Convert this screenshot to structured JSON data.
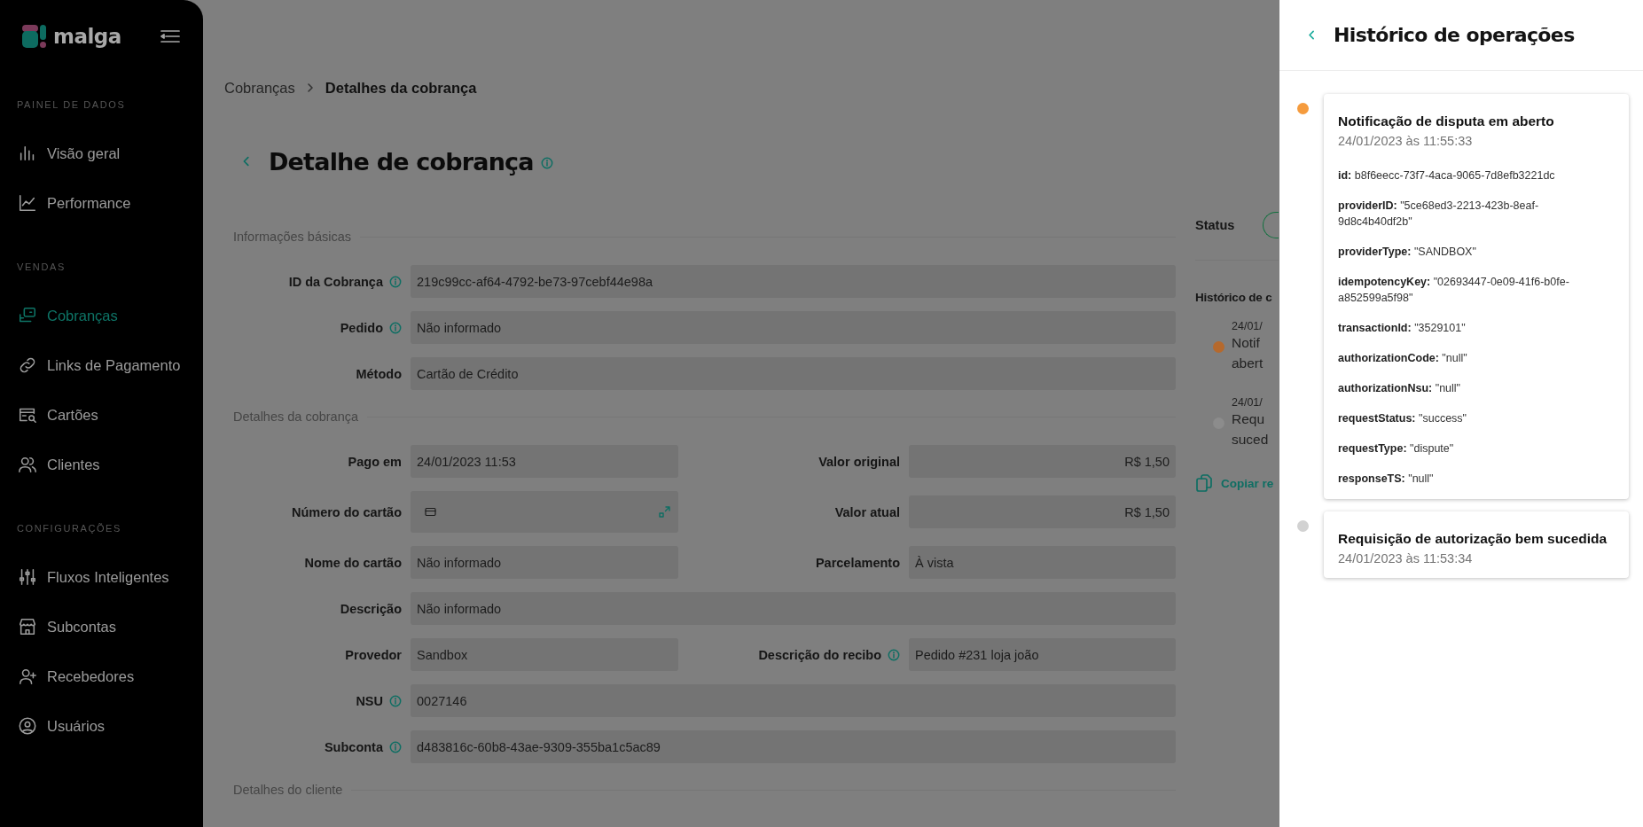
{
  "sidebar": {
    "logo": "malga",
    "sections": [
      {
        "title": "PAINEL DE DADOS",
        "items": [
          {
            "label": "Visão geral",
            "selected": false
          },
          {
            "label": "Performance",
            "selected": false
          }
        ]
      },
      {
        "title": "VENDAS",
        "items": [
          {
            "label": "Cobranças",
            "selected": true
          },
          {
            "label": "Links de Pagamento",
            "selected": false
          },
          {
            "label": "Cartões",
            "selected": false
          },
          {
            "label": "Clientes",
            "selected": false
          }
        ]
      },
      {
        "title": "CONFIGURAÇÕES",
        "items": [
          {
            "label": "Fluxos Inteligentes",
            "selected": false
          },
          {
            "label": "Subcontas",
            "selected": false
          },
          {
            "label": "Recebedores",
            "selected": false
          },
          {
            "label": "Usuários",
            "selected": false
          }
        ]
      }
    ]
  },
  "main": {
    "breadcrumb": [
      {
        "label": "Cobranças",
        "current": false
      },
      {
        "label": "Detalhes da cobrança",
        "current": true
      }
    ],
    "page_title": "Detalhe de cobrança",
    "sections": [
      {
        "title": "Informações básicas",
        "rows": [
          [
            {
              "label": "ID da Cobrança",
              "info": true,
              "kind": "text",
              "value": "219c99cc-af64-4792-be73-97cebf44e98a"
            }
          ],
          [
            {
              "label": "Pedido",
              "info": true,
              "kind": "text",
              "value": "Não informado"
            }
          ],
          [
            {
              "label": "Método",
              "kind": "text",
              "value": "Cartão de Crédito"
            }
          ]
        ]
      },
      {
        "title": "Detalhes da cobrança",
        "rows": [
          [
            {
              "label": "Pago em",
              "kind": "text",
              "value": "24/01/2023 11:53"
            },
            {
              "label": "Valor original",
              "kind": "amount",
              "value": "R$ 1,50"
            }
          ],
          [
            {
              "label": "Número do cartão",
              "kind": "card"
            },
            {
              "label": "Valor atual",
              "kind": "amount",
              "value": "R$ 1,50"
            }
          ],
          [
            {
              "label": "Nome do cartão",
              "kind": "text",
              "value": "Não informado"
            },
            {
              "label": "Parcelamento",
              "kind": "text",
              "value": "À vista"
            }
          ],
          [
            {
              "label": "Descrição",
              "kind": "text",
              "value": "Não informado"
            }
          ],
          [
            {
              "label": "Provedor",
              "kind": "text",
              "value": "Sandbox"
            },
            {
              "label": "Descrição do recibo",
              "info": true,
              "kind": "text",
              "value": "Pedido #231 loja joão"
            }
          ],
          [
            {
              "label": "NSU",
              "info": true,
              "kind": "text",
              "value": "0027146"
            }
          ],
          [
            {
              "label": "Subconta",
              "info": true,
              "kind": "text",
              "value": "d483816c-60b8-43ae-9309-355ba1c5ac89"
            }
          ]
        ]
      },
      {
        "title": "Detalhes do cliente"
      }
    ],
    "side": {
      "status_label": "Status",
      "history_title": "Histórico de c",
      "timeline": [
        {
          "date": "24/01/",
          "lines": [
            "Notif",
            "abert"
          ],
          "color": "#b5692d"
        },
        {
          "date": "24/01/",
          "lines": [
            "Requ",
            "suced"
          ],
          "color": "#8c8c8c"
        }
      ],
      "copy_link": "Copiar re"
    }
  },
  "drawer": {
    "title": "Histórico de operações",
    "events": [
      {
        "title": "Notificação de disputa em aberto",
        "time": "24/01/2023 às 11:55:33",
        "color": "#f59b3d",
        "details": [
          {
            "key": "id:",
            "value": "b8f6eecc-73f7-4aca-9065-7d8efb3221dc"
          },
          {
            "key": "providerID:",
            "value": "\"5ce68ed3-2213-423b-8eaf-9d8c4b40df2b\""
          },
          {
            "key": "providerType:",
            "value": "\"SANDBOX\""
          },
          {
            "key": "idempotencyKey:",
            "value": "\"02693447-0e09-41f6-b0fe-a852599a5f98\""
          },
          {
            "key": "transactionId:",
            "value": "\"3529101\""
          },
          {
            "key": "authorizationCode:",
            "value": "\"null\""
          },
          {
            "key": "authorizationNsu:",
            "value": "\"null\""
          },
          {
            "key": "requestStatus:",
            "value": "\"success\""
          },
          {
            "key": "requestType:",
            "value": "\"dispute\""
          },
          {
            "key": "responseTS:",
            "value": "\"null\""
          }
        ]
      },
      {
        "title": "Requisição de autorização bem sucedida",
        "time": "24/01/2023 às 11:53:34",
        "color": "#d2d2d2"
      }
    ]
  }
}
